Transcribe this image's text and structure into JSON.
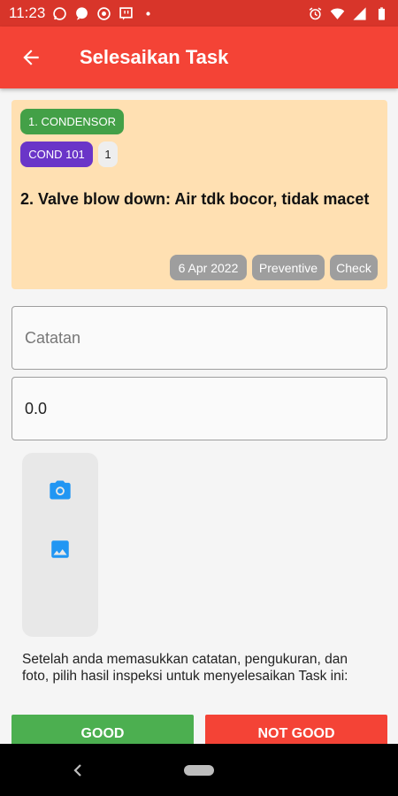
{
  "status_bar": {
    "time": "11:23",
    "left_icons": [
      "whatsapp-icon",
      "chat-bubble-icon",
      "chrome-icon",
      "twitch-icon",
      "dot-icon"
    ],
    "right_icons": [
      "alarm-icon",
      "wifi-icon",
      "signal-icon",
      "battery-icon"
    ]
  },
  "app_bar": {
    "title": "Selesaikan Task",
    "back_icon": "arrow-back-icon",
    "color": "#f44336"
  },
  "task_card": {
    "category": "1. CONDENSOR",
    "asset_code": "COND 101",
    "asset_count": "1",
    "title": "2. Valve blow down: Air tdk bocor, tidak macet",
    "date": "6 Apr 2022",
    "type": "Preventive",
    "action": "Check",
    "background": "#ffe0b2"
  },
  "form": {
    "notes_placeholder": "Catatan",
    "notes_value": "",
    "measurement_value": "0.0"
  },
  "photo": {
    "camera_icon": "camera-icon",
    "gallery_icon": "image-icon",
    "icon_color": "#2196f3"
  },
  "instruction": "Setelah anda memasukkan catatan, pengukuran, dan foto, pilih hasil inspeksi untuk menyelesaikan Task ini:",
  "actions": {
    "good_label": "GOOD",
    "not_good_label": "NOT GOOD",
    "good_color": "#4caf50",
    "not_good_color": "#f44336"
  },
  "nav_bar": {
    "back_icon": "nav-back-icon",
    "home_icon": "nav-home-icon"
  }
}
